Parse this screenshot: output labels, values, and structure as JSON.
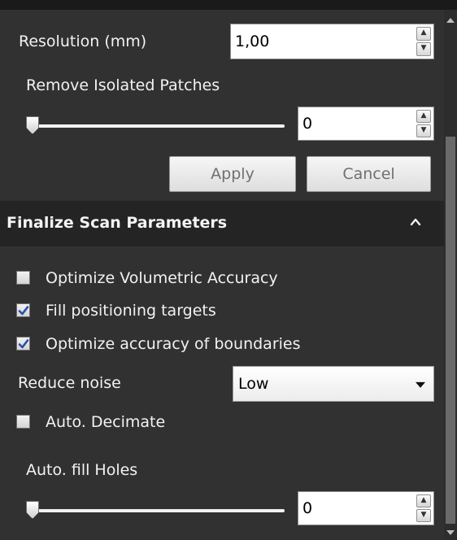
{
  "resolution": {
    "label": "Resolution (mm)",
    "value": "1,00"
  },
  "remove_isolated_patches": {
    "label": "Remove Isolated Patches",
    "value": "0",
    "level": 0
  },
  "buttons": {
    "apply": "Apply",
    "cancel": "Cancel"
  },
  "finalize_section": {
    "title": "Finalize Scan Parameters",
    "options": [
      {
        "label": "Optimize Volumetric Accuracy",
        "checked": false
      },
      {
        "label": "Fill positioning targets",
        "checked": true
      },
      {
        "label": "Optimize accuracy of boundaries",
        "checked": true
      }
    ],
    "reduce_noise": {
      "label": "Reduce noise",
      "value": "Low"
    },
    "auto_decimate": {
      "label": "Auto. Decimate",
      "checked": false
    },
    "auto_fill_holes": {
      "label": "Auto. fill Holes",
      "value": "0",
      "level": 0
    }
  },
  "icons": {
    "spin_up": "spin-up-arrow-icon",
    "spin_down": "spin-down-arrow-icon",
    "collapse": "chevron-up-icon",
    "dropdown": "dropdown-caret-icon"
  },
  "colors": {
    "panel_bg": "#313131",
    "header_bg": "#242424",
    "checkmark": "#2a4fa8"
  }
}
